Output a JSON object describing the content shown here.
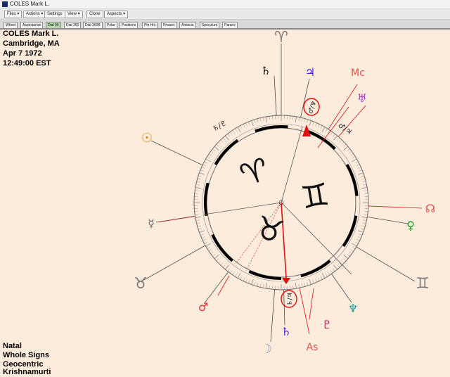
{
  "window": {
    "title": "COLES Mark L."
  },
  "menu": [
    {
      "label": "Files ▾",
      "icon": "none"
    },
    {
      "label": "Actions ▾"
    },
    {
      "label": "Settings"
    },
    {
      "label": "View ▾"
    },
    {
      "label": "Clone"
    },
    {
      "label": "Aspects ▾"
    }
  ],
  "tabs": [
    {
      "label": "Wheel",
      "active": false
    },
    {
      "label": "Aspectarian",
      "active": false
    },
    {
      "label": "Dial 90",
      "active": true
    },
    {
      "label": "Dial 360",
      "active": false
    },
    {
      "label": "Dial 360B",
      "active": false
    },
    {
      "label": "Polar",
      "active": false
    },
    {
      "label": "Positions",
      "active": false
    },
    {
      "label": "Pln Hrs",
      "active": false
    },
    {
      "label": "Phases",
      "active": false
    },
    {
      "label": "Antiscia",
      "active": false
    },
    {
      "label": "Speculum",
      "active": false
    },
    {
      "label": "Parans",
      "active": false
    }
  ],
  "person": {
    "name": "COLES Mark L.",
    "place": "Cambridge, MA",
    "date": "Apr 7 1972",
    "time": "12:49:00  EST"
  },
  "settings": {
    "type": "Natal",
    "houses": "Whole Signs",
    "center": "Geocentric",
    "system": "Krishnamurti"
  },
  "dial": {
    "inner_signs": [
      "♈",
      "♊",
      "♉"
    ],
    "outer_signs": [
      "♈",
      "♉",
      "♊"
    ],
    "bodies": [
      {
        "name": "saturn",
        "glyph": "♄",
        "color": "#000000"
      },
      {
        "name": "jupiter",
        "glyph": "♃",
        "color": "#3d1fd0"
      },
      {
        "name": "midheaven",
        "glyph": "Mc",
        "color": "#e0504a"
      },
      {
        "name": "uranus",
        "glyph": "♅",
        "color": "#b03fd0"
      },
      {
        "name": "sun",
        "glyph": "☉",
        "color": "#e08a1a"
      },
      {
        "name": "node",
        "glyph": "☊",
        "color": "#e0504a"
      },
      {
        "name": "venus",
        "glyph": "♀",
        "color": "#1a9a2a"
      },
      {
        "name": "mercury",
        "glyph": "☿",
        "color": "#6a6a6a"
      },
      {
        "name": "mars",
        "glyph": "♂",
        "color": "#e0302a"
      },
      {
        "name": "neptune",
        "glyph": "♆",
        "color": "#1a9a9a"
      },
      {
        "name": "pluto",
        "glyph": "♇",
        "color": "#b0306a"
      },
      {
        "name": "saturn-lower",
        "glyph": "♄",
        "color": "#3d1fd0"
      },
      {
        "name": "moon",
        "glyph": "☽",
        "color": "#8a9ad0"
      },
      {
        "name": "ascendant",
        "glyph": "As",
        "color": "#e0504a"
      }
    ],
    "midpoint_labels": [
      "♄/♇",
      "♂/♃"
    ],
    "circled_labels": [
      "♂/♆",
      "♄/♃"
    ]
  },
  "colors": {
    "background": "#fdebdc",
    "pointer": "#e01010",
    "highlight": "#e01010"
  }
}
